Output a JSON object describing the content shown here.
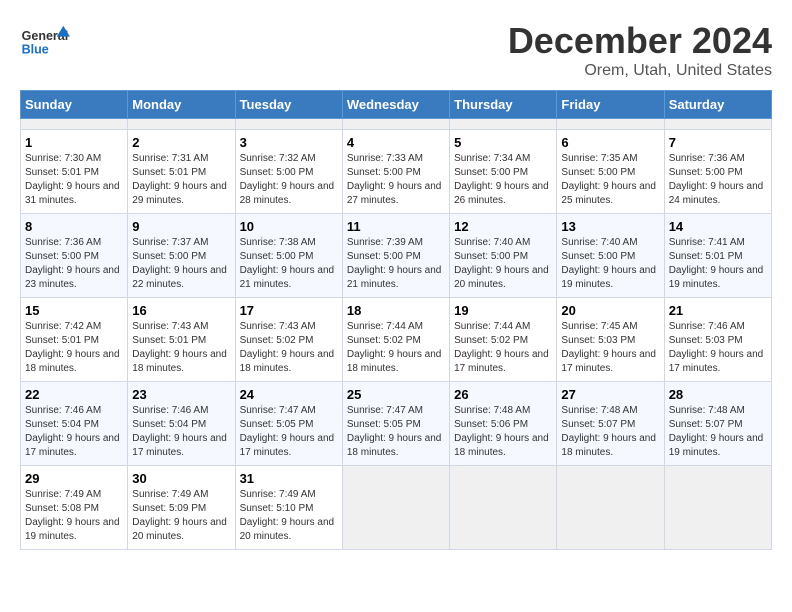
{
  "header": {
    "logo_general": "General",
    "logo_blue": "Blue",
    "month_title": "December 2024",
    "location": "Orem, Utah, United States"
  },
  "calendar": {
    "days_of_week": [
      "Sunday",
      "Monday",
      "Tuesday",
      "Wednesday",
      "Thursday",
      "Friday",
      "Saturday"
    ],
    "weeks": [
      [
        {
          "day": "",
          "empty": true
        },
        {
          "day": "",
          "empty": true
        },
        {
          "day": "",
          "empty": true
        },
        {
          "day": "",
          "empty": true
        },
        {
          "day": "",
          "empty": true
        },
        {
          "day": "",
          "empty": true
        },
        {
          "day": "",
          "empty": true
        }
      ],
      [
        {
          "day": "1",
          "sunrise": "Sunrise: 7:30 AM",
          "sunset": "Sunset: 5:01 PM",
          "daylight": "Daylight: 9 hours and 31 minutes."
        },
        {
          "day": "2",
          "sunrise": "Sunrise: 7:31 AM",
          "sunset": "Sunset: 5:01 PM",
          "daylight": "Daylight: 9 hours and 29 minutes."
        },
        {
          "day": "3",
          "sunrise": "Sunrise: 7:32 AM",
          "sunset": "Sunset: 5:00 PM",
          "daylight": "Daylight: 9 hours and 28 minutes."
        },
        {
          "day": "4",
          "sunrise": "Sunrise: 7:33 AM",
          "sunset": "Sunset: 5:00 PM",
          "daylight": "Daylight: 9 hours and 27 minutes."
        },
        {
          "day": "5",
          "sunrise": "Sunrise: 7:34 AM",
          "sunset": "Sunset: 5:00 PM",
          "daylight": "Daylight: 9 hours and 26 minutes."
        },
        {
          "day": "6",
          "sunrise": "Sunrise: 7:35 AM",
          "sunset": "Sunset: 5:00 PM",
          "daylight": "Daylight: 9 hours and 25 minutes."
        },
        {
          "day": "7",
          "sunrise": "Sunrise: 7:36 AM",
          "sunset": "Sunset: 5:00 PM",
          "daylight": "Daylight: 9 hours and 24 minutes."
        }
      ],
      [
        {
          "day": "8",
          "sunrise": "Sunrise: 7:36 AM",
          "sunset": "Sunset: 5:00 PM",
          "daylight": "Daylight: 9 hours and 23 minutes."
        },
        {
          "day": "9",
          "sunrise": "Sunrise: 7:37 AM",
          "sunset": "Sunset: 5:00 PM",
          "daylight": "Daylight: 9 hours and 22 minutes."
        },
        {
          "day": "10",
          "sunrise": "Sunrise: 7:38 AM",
          "sunset": "Sunset: 5:00 PM",
          "daylight": "Daylight: 9 hours and 21 minutes."
        },
        {
          "day": "11",
          "sunrise": "Sunrise: 7:39 AM",
          "sunset": "Sunset: 5:00 PM",
          "daylight": "Daylight: 9 hours and 21 minutes."
        },
        {
          "day": "12",
          "sunrise": "Sunrise: 7:40 AM",
          "sunset": "Sunset: 5:00 PM",
          "daylight": "Daylight: 9 hours and 20 minutes."
        },
        {
          "day": "13",
          "sunrise": "Sunrise: 7:40 AM",
          "sunset": "Sunset: 5:00 PM",
          "daylight": "Daylight: 9 hours and 19 minutes."
        },
        {
          "day": "14",
          "sunrise": "Sunrise: 7:41 AM",
          "sunset": "Sunset: 5:01 PM",
          "daylight": "Daylight: 9 hours and 19 minutes."
        }
      ],
      [
        {
          "day": "15",
          "sunrise": "Sunrise: 7:42 AM",
          "sunset": "Sunset: 5:01 PM",
          "daylight": "Daylight: 9 hours and 18 minutes."
        },
        {
          "day": "16",
          "sunrise": "Sunrise: 7:43 AM",
          "sunset": "Sunset: 5:01 PM",
          "daylight": "Daylight: 9 hours and 18 minutes."
        },
        {
          "day": "17",
          "sunrise": "Sunrise: 7:43 AM",
          "sunset": "Sunset: 5:02 PM",
          "daylight": "Daylight: 9 hours and 18 minutes."
        },
        {
          "day": "18",
          "sunrise": "Sunrise: 7:44 AM",
          "sunset": "Sunset: 5:02 PM",
          "daylight": "Daylight: 9 hours and 18 minutes."
        },
        {
          "day": "19",
          "sunrise": "Sunrise: 7:44 AM",
          "sunset": "Sunset: 5:02 PM",
          "daylight": "Daylight: 9 hours and 17 minutes."
        },
        {
          "day": "20",
          "sunrise": "Sunrise: 7:45 AM",
          "sunset": "Sunset: 5:03 PM",
          "daylight": "Daylight: 9 hours and 17 minutes."
        },
        {
          "day": "21",
          "sunrise": "Sunrise: 7:46 AM",
          "sunset": "Sunset: 5:03 PM",
          "daylight": "Daylight: 9 hours and 17 minutes."
        }
      ],
      [
        {
          "day": "22",
          "sunrise": "Sunrise: 7:46 AM",
          "sunset": "Sunset: 5:04 PM",
          "daylight": "Daylight: 9 hours and 17 minutes."
        },
        {
          "day": "23",
          "sunrise": "Sunrise: 7:46 AM",
          "sunset": "Sunset: 5:04 PM",
          "daylight": "Daylight: 9 hours and 17 minutes."
        },
        {
          "day": "24",
          "sunrise": "Sunrise: 7:47 AM",
          "sunset": "Sunset: 5:05 PM",
          "daylight": "Daylight: 9 hours and 17 minutes."
        },
        {
          "day": "25",
          "sunrise": "Sunrise: 7:47 AM",
          "sunset": "Sunset: 5:05 PM",
          "daylight": "Daylight: 9 hours and 18 minutes."
        },
        {
          "day": "26",
          "sunrise": "Sunrise: 7:48 AM",
          "sunset": "Sunset: 5:06 PM",
          "daylight": "Daylight: 9 hours and 18 minutes."
        },
        {
          "day": "27",
          "sunrise": "Sunrise: 7:48 AM",
          "sunset": "Sunset: 5:07 PM",
          "daylight": "Daylight: 9 hours and 18 minutes."
        },
        {
          "day": "28",
          "sunrise": "Sunrise: 7:48 AM",
          "sunset": "Sunset: 5:07 PM",
          "daylight": "Daylight: 9 hours and 19 minutes."
        }
      ],
      [
        {
          "day": "29",
          "sunrise": "Sunrise: 7:49 AM",
          "sunset": "Sunset: 5:08 PM",
          "daylight": "Daylight: 9 hours and 19 minutes."
        },
        {
          "day": "30",
          "sunrise": "Sunrise: 7:49 AM",
          "sunset": "Sunset: 5:09 PM",
          "daylight": "Daylight: 9 hours and 20 minutes."
        },
        {
          "day": "31",
          "sunrise": "Sunrise: 7:49 AM",
          "sunset": "Sunset: 5:10 PM",
          "daylight": "Daylight: 9 hours and 20 minutes."
        },
        {
          "day": "",
          "empty": true
        },
        {
          "day": "",
          "empty": true
        },
        {
          "day": "",
          "empty": true
        },
        {
          "day": "",
          "empty": true
        }
      ]
    ]
  }
}
